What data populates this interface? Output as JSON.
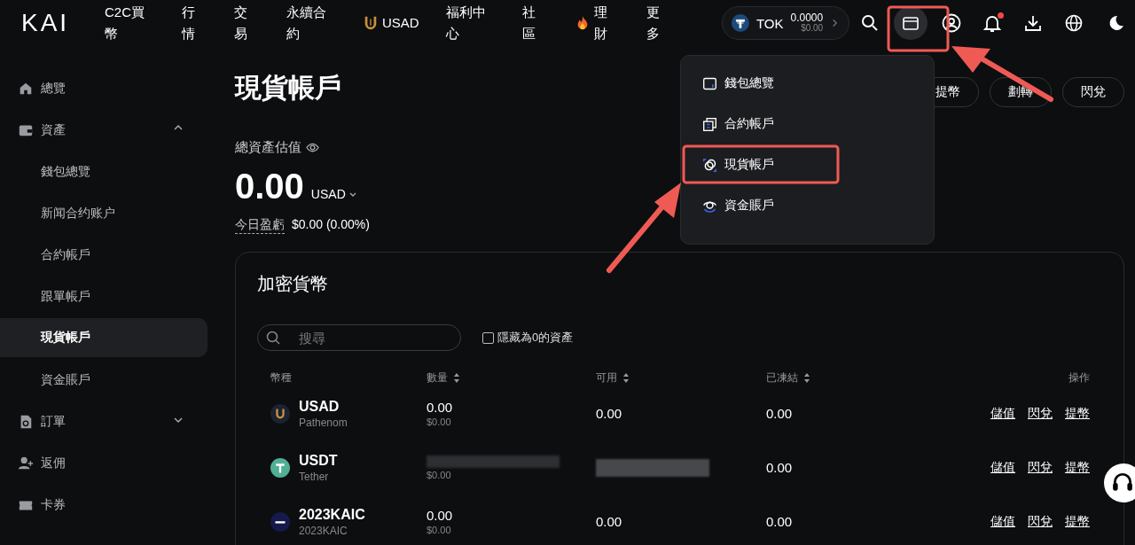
{
  "header": {
    "logo": "KAI",
    "nav": [
      {
        "label": "C2C買幣",
        "kind": "plain"
      },
      {
        "label": "行情",
        "kind": "plain"
      },
      {
        "label": "交易",
        "kind": "plain"
      },
      {
        "label": "永續合約",
        "kind": "plain"
      },
      {
        "label": "USAD",
        "kind": "token"
      },
      {
        "label": "福利中心",
        "kind": "plain"
      },
      {
        "label": "社區",
        "kind": "plain"
      },
      {
        "label": "理財",
        "kind": "promo"
      },
      {
        "label": "更多",
        "kind": "plain"
      }
    ],
    "token": {
      "symbol": "TOK",
      "amount": "0.0000",
      "value": "$0.00"
    },
    "notification_dot": true
  },
  "sidebar": {
    "items": [
      {
        "label": "總覽",
        "kind": "top",
        "selected": false
      },
      {
        "label": "資產",
        "kind": "group",
        "expanded": true,
        "children": [
          {
            "label": "錢包總覽",
            "selected": false
          },
          {
            "label": "新闻合约账户",
            "selected": false
          },
          {
            "label": "合約帳戶",
            "selected": false
          },
          {
            "label": "跟單帳戶",
            "selected": false
          },
          {
            "label": "現貨帳戶",
            "selected": true
          },
          {
            "label": "資金賬戶",
            "selected": false
          }
        ]
      },
      {
        "label": "訂單",
        "kind": "group",
        "expanded": false
      },
      {
        "label": "返佣",
        "kind": "top",
        "selected": false
      },
      {
        "label": "卡券",
        "kind": "top",
        "selected": false
      }
    ]
  },
  "page": {
    "title": "現貨帳戶",
    "actions": [
      "提幣",
      "劃轉",
      "閃兌"
    ],
    "total_label": "總資產估值",
    "total_value": "0.00",
    "currency": "USAD",
    "pnl_label": "今日盈虧",
    "pnl_value": "$0.00 (0.00%)"
  },
  "card": {
    "title": "加密貨幣",
    "search": {
      "placeholder": "搜尋"
    },
    "hide_zero": {
      "label": "隱藏為0的資產",
      "checked": false
    },
    "table": {
      "columns": [
        {
          "label": "幣種",
          "sortable": false
        },
        {
          "label": "數量",
          "sortable": true
        },
        {
          "label": "可用",
          "sortable": true
        },
        {
          "label": "已凍結",
          "sortable": true
        },
        {
          "label": "操作",
          "sortable": false
        }
      ],
      "rows": [
        {
          "symbol": "USAD",
          "name": "Pathenom",
          "quantity": "0.00",
          "quantity_usd": "$0.00",
          "available": "0.00",
          "frozen": "0.00",
          "redacted": false,
          "actions": [
            "儲值",
            "閃兌",
            "提幣"
          ]
        },
        {
          "symbol": "USDT",
          "name": "Tether",
          "quantity_usd": "$0.00",
          "frozen": "0.00",
          "redacted": true,
          "actions": [
            "儲值",
            "閃兌",
            "提幣"
          ]
        },
        {
          "symbol": "2023KAIC",
          "name": "2023KAIC",
          "quantity": "0.00",
          "quantity_usd": "$0.00",
          "available": "0.00",
          "frozen": "0.00",
          "redacted": false,
          "actions": [
            "儲值",
            "閃兌",
            "提幣"
          ]
        }
      ]
    }
  },
  "wallet_menu": {
    "items": [
      "錢包總覽",
      "合約帳戶",
      "現貨帳戶",
      "資金賬戶"
    ]
  }
}
